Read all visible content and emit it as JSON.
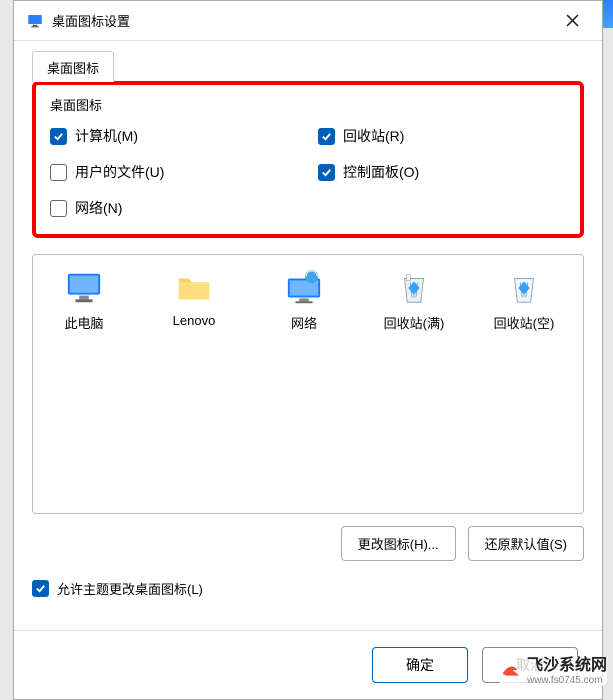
{
  "titlebar": {
    "title": "桌面图标设置"
  },
  "tab": {
    "label": "桌面图标"
  },
  "group": {
    "title": "桌面图标",
    "checkboxes": [
      {
        "label": "计算机(M)",
        "checked": true
      },
      {
        "label": "回收站(R)",
        "checked": true
      },
      {
        "label": "用户的文件(U)",
        "checked": false
      },
      {
        "label": "控制面板(O)",
        "checked": true
      },
      {
        "label": "网络(N)",
        "checked": false
      }
    ]
  },
  "icons": [
    {
      "label": "此电脑",
      "kind": "monitor"
    },
    {
      "label": "Lenovo",
      "kind": "folder"
    },
    {
      "label": "网络",
      "kind": "network"
    },
    {
      "label": "回收站(满)",
      "kind": "recycle-full"
    },
    {
      "label": "回收站(空)",
      "kind": "recycle-empty"
    }
  ],
  "buttons": {
    "change_icon": "更改图标(H)...",
    "restore_default": "还原默认值(S)"
  },
  "allow_theme": {
    "label": "允许主题更改桌面图标(L)",
    "checked": true
  },
  "footer": {
    "ok": "确定",
    "cancel": "取消"
  },
  "watermark": {
    "text": "飞沙系统网",
    "sub": "www.fs0745.com"
  }
}
